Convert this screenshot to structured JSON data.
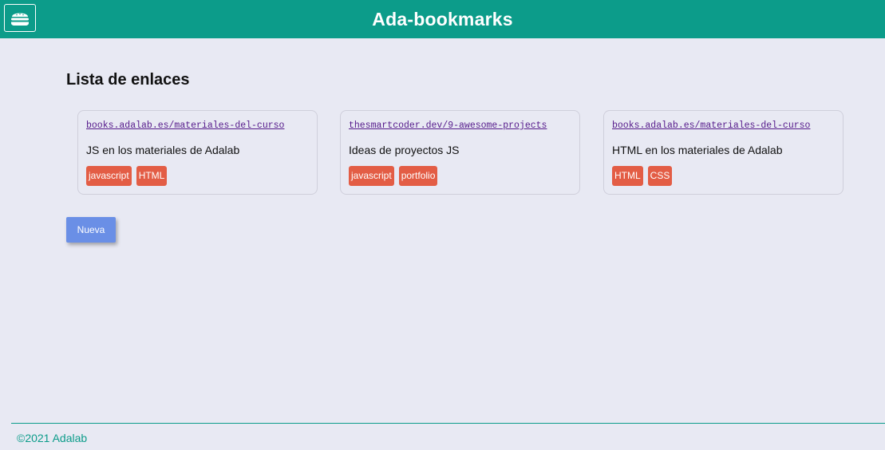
{
  "header": {
    "title": "Ada-bookmarks",
    "menu_icon": "hamburger-menu-icon"
  },
  "main": {
    "section_title": "Lista de enlaces",
    "cards": [
      {
        "url": "books.adalab.es/materiales-del-curso",
        "description": "JS en los materiales de Adalab",
        "tags": [
          "javascript",
          "HTML"
        ]
      },
      {
        "url": "thesmartcoder.dev/9-awesome-projects",
        "description": "Ideas de proyectos JS",
        "tags": [
          "javascript",
          "portfolio"
        ]
      },
      {
        "url": "books.adalab.es/materiales-del-curso",
        "description": "HTML en los materiales de Adalab",
        "tags": [
          "HTML",
          "CSS"
        ]
      }
    ],
    "new_button_label": "Nueva"
  },
  "footer": {
    "text": "©2021 Adalab"
  },
  "colors": {
    "primary": "#0c9c8a",
    "background": "#e8e9f3",
    "tag": "#e35d45",
    "button": "#6a8fe6"
  }
}
